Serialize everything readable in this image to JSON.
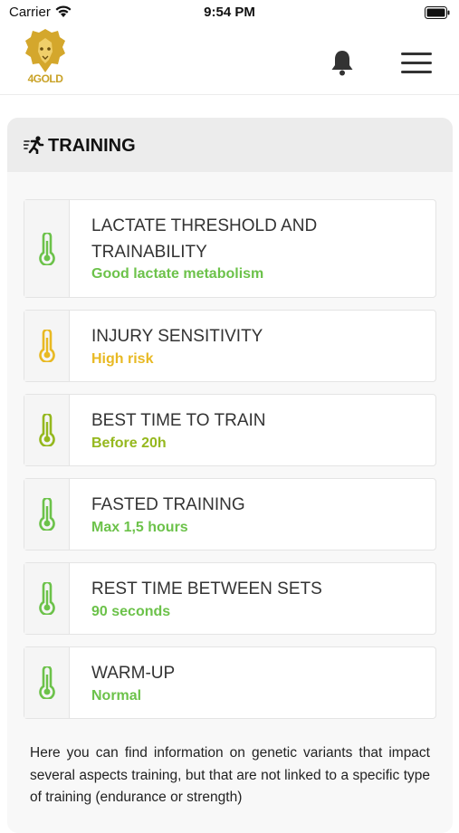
{
  "status_bar": {
    "carrier": "Carrier",
    "time": "9:54 PM"
  },
  "header": {
    "logo_text": "4GOLD"
  },
  "section": {
    "title": "TRAINING",
    "items": [
      {
        "name": "LACTATE THRESHOLD AND TRAINABILITY",
        "value": "Good lactate metabolism",
        "color": "#6cc24a",
        "icon": "thermometer-icon"
      },
      {
        "name": "INJURY SENSITIVITY",
        "value": "High risk",
        "color": "#e8b923",
        "icon": "thermometer-icon"
      },
      {
        "name": "BEST TIME TO TRAIN",
        "value": "Before 20h",
        "color": "#95b81e",
        "icon": "thermometer-icon"
      },
      {
        "name": "FASTED TRAINING",
        "value": "Max 1,5 hours",
        "color": "#6cc24a",
        "icon": "thermometer-icon"
      },
      {
        "name": "REST TIME BETWEEN SETS",
        "value": "90 seconds",
        "color": "#6cc24a",
        "icon": "thermometer-icon"
      },
      {
        "name": "WARM-UP",
        "value": "Normal",
        "color": "#6cc24a",
        "icon": "thermometer-icon"
      }
    ],
    "description": "Here you can find information on genetic variants that impact several aspects training, but that are not linked to a specific type of training (endurance or strength)"
  }
}
